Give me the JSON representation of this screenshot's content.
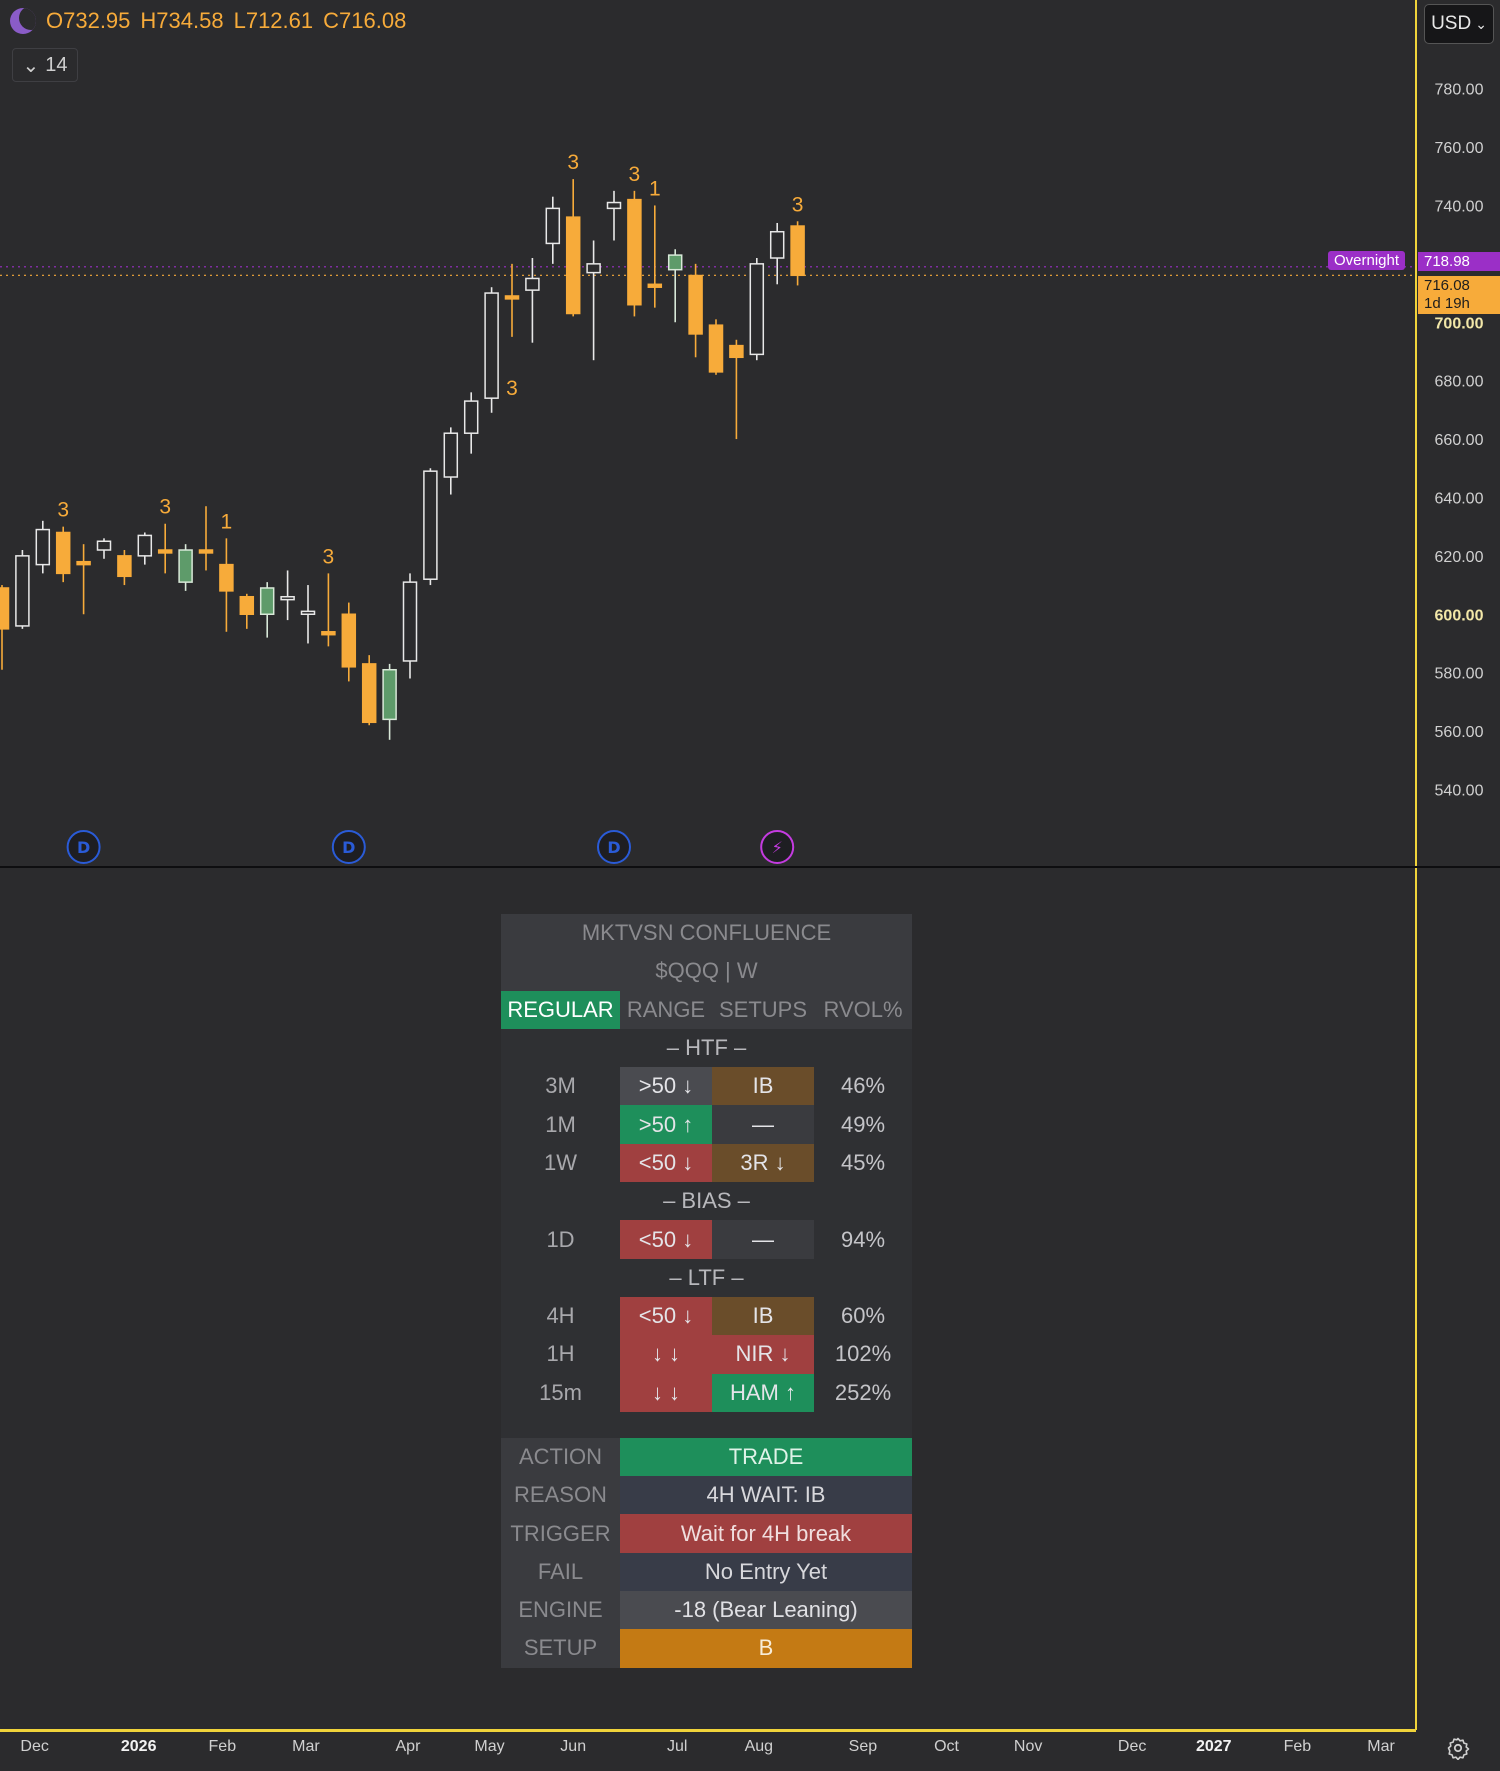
{
  "header": {
    "ohlc": {
      "open": "O732.95",
      "high": "H734.58",
      "low": "L712.61",
      "close": "C716.08"
    },
    "indicator_count": "14",
    "currency": "USD",
    "moon_icon": "moon-icon"
  },
  "tags": {
    "overnight_label": "Overnight",
    "overnight_price": "718.98",
    "last_price": "716.08",
    "countdown": "1d 19h"
  },
  "colors": {
    "bull": "#ffffff",
    "bear": "#f7ab3a",
    "green": "#5e9b6a",
    "grid_bg": "#2b2b2d",
    "accent": "#f0d33a",
    "overnight": "#9b2fc7"
  },
  "chart_data": {
    "type": "candlestick",
    "ylim": [
      525,
      800
    ],
    "yticks": [
      {
        "v": 780,
        "label": "780.00",
        "bold": false
      },
      {
        "v": 760,
        "label": "760.00",
        "bold": false
      },
      {
        "v": 740,
        "label": "740.00",
        "bold": false
      },
      {
        "v": 700,
        "label": "700.00",
        "bold": true
      },
      {
        "v": 680,
        "label": "680.00",
        "bold": false
      },
      {
        "v": 660,
        "label": "660.00",
        "bold": false
      },
      {
        "v": 640,
        "label": "640.00",
        "bold": false
      },
      {
        "v": 620,
        "label": "620.00",
        "bold": false
      },
      {
        "v": 600,
        "label": "600.00",
        "bold": true
      },
      {
        "v": 580,
        "label": "580.00",
        "bold": false
      },
      {
        "v": 560,
        "label": "560.00",
        "bold": false
      },
      {
        "v": 540,
        "label": "540.00",
        "bold": false
      }
    ],
    "xticks": [
      {
        "label": "Dec",
        "idx": 1.6,
        "bold": false
      },
      {
        "label": "2026",
        "idx": 6.7,
        "bold": true
      },
      {
        "label": "Feb",
        "idx": 10.8,
        "bold": false
      },
      {
        "label": "Mar",
        "idx": 14.9,
        "bold": false
      },
      {
        "label": "Apr",
        "idx": 19.9,
        "bold": false
      },
      {
        "label": "May",
        "idx": 23.9,
        "bold": false
      },
      {
        "label": "Jun",
        "idx": 28.0,
        "bold": false
      },
      {
        "label": "Jul",
        "idx": 33.1,
        "bold": false
      },
      {
        "label": "Aug",
        "idx": 37.1,
        "bold": false
      },
      {
        "label": "Sep",
        "idx": 42.2,
        "bold": false
      },
      {
        "label": "Oct",
        "idx": 46.3,
        "bold": false
      },
      {
        "label": "Nov",
        "idx": 50.3,
        "bold": false
      },
      {
        "label": "Dec",
        "idx": 55.4,
        "bold": false
      },
      {
        "label": "2027",
        "idx": 59.4,
        "bold": true
      },
      {
        "label": "Feb",
        "idx": 63.5,
        "bold": false
      },
      {
        "label": "Mar",
        "idx": 67.6,
        "bold": false
      }
    ],
    "overnight": 718.98,
    "last": 716.08,
    "candles": [
      {
        "o": 609,
        "c": 595,
        "h": 610,
        "l": 581,
        "col": "bear"
      },
      {
        "o": 596,
        "c": 620,
        "h": 622,
        "l": 595,
        "col": "bull"
      },
      {
        "o": 617,
        "c": 629,
        "h": 632,
        "l": 614,
        "col": "bull"
      },
      {
        "o": 628,
        "c": 614,
        "h": 630,
        "l": 611,
        "col": "bear",
        "lbl": "3"
      },
      {
        "o": 618,
        "c": 617,
        "h": 624,
        "l": 600,
        "col": "bear"
      },
      {
        "o": 622,
        "c": 625,
        "h": 626,
        "l": 619,
        "col": "bull"
      },
      {
        "o": 620,
        "c": 613,
        "h": 622,
        "l": 610,
        "col": "bear"
      },
      {
        "o": 620,
        "c": 627,
        "h": 628,
        "l": 617,
        "col": "bull"
      },
      {
        "o": 622,
        "c": 621,
        "h": 631,
        "l": 614,
        "col": "bear",
        "lbl": "3"
      },
      {
        "o": 611,
        "c": 622,
        "h": 624,
        "l": 608,
        "col": "green"
      },
      {
        "o": 622,
        "c": 621,
        "h": 637,
        "l": 615,
        "col": "bear"
      },
      {
        "o": 617,
        "c": 608,
        "h": 626,
        "l": 594,
        "col": "bear",
        "lbl": "1"
      },
      {
        "o": 606,
        "c": 600,
        "h": 607,
        "l": 595,
        "col": "bear"
      },
      {
        "o": 600,
        "c": 609,
        "h": 611,
        "l": 592,
        "col": "green"
      },
      {
        "o": 605,
        "c": 606,
        "h": 615,
        "l": 598,
        "col": "bull"
      },
      {
        "o": 600,
        "c": 601,
        "h": 610,
        "l": 590,
        "col": "bull"
      },
      {
        "o": 594,
        "c": 593,
        "h": 614,
        "l": 589,
        "col": "bear",
        "lbl": "3"
      },
      {
        "o": 600,
        "c": 582,
        "h": 604,
        "l": 577,
        "col": "bear"
      },
      {
        "o": 583,
        "c": 563,
        "h": 586,
        "l": 562,
        "col": "bear"
      },
      {
        "o": 564,
        "c": 581,
        "h": 583,
        "l": 557,
        "col": "green"
      },
      {
        "o": 584,
        "c": 611,
        "h": 614,
        "l": 578,
        "col": "bull"
      },
      {
        "o": 612,
        "c": 649,
        "h": 650,
        "l": 610,
        "col": "bull"
      },
      {
        "o": 647,
        "c": 662,
        "h": 664,
        "l": 641,
        "col": "bull"
      },
      {
        "o": 662,
        "c": 673,
        "h": 676,
        "l": 655,
        "col": "bull"
      },
      {
        "o": 674,
        "c": 710,
        "h": 712,
        "l": 669,
        "col": "bull"
      },
      {
        "o": 709,
        "c": 708,
        "h": 720,
        "l": 695,
        "col": "bear",
        "lbl_low": "3"
      },
      {
        "o": 711,
        "c": 715,
        "h": 722,
        "l": 693,
        "col": "bull"
      },
      {
        "o": 727,
        "c": 739,
        "h": 743,
        "l": 720,
        "col": "bull"
      },
      {
        "o": 736,
        "c": 703,
        "h": 749,
        "l": 702,
        "col": "bear",
        "lbl": "3"
      },
      {
        "o": 717,
        "c": 720,
        "h": 728,
        "l": 687,
        "col": "bull"
      },
      {
        "o": 739,
        "c": 741,
        "h": 745,
        "l": 728,
        "col": "bull"
      },
      {
        "o": 742,
        "c": 706,
        "h": 745,
        "l": 702,
        "col": "bear",
        "lbl": "3"
      },
      {
        "o": 713,
        "c": 712,
        "h": 740,
        "l": 705,
        "col": "bear",
        "lbl": "1"
      },
      {
        "o": 718,
        "c": 723,
        "h": 725,
        "l": 700,
        "col": "green"
      },
      {
        "o": 716,
        "c": 696,
        "h": 720,
        "l": 688,
        "col": "bear"
      },
      {
        "o": 699,
        "c": 683,
        "h": 701,
        "l": 682,
        "col": "bear"
      },
      {
        "o": 692,
        "c": 688,
        "h": 694,
        "l": 660,
        "col": "bear"
      },
      {
        "o": 689,
        "c": 720,
        "h": 722,
        "l": 687,
        "col": "bull"
      },
      {
        "o": 722,
        "c": 731,
        "h": 734,
        "l": 713,
        "col": "bull"
      },
      {
        "o": 732.95,
        "c": 716.08,
        "h": 734.58,
        "l": 712.61,
        "col": "bear",
        "lbl": "3"
      }
    ],
    "markers": [
      {
        "idx": 4,
        "label": "D",
        "kind": "div"
      },
      {
        "idx": 17,
        "label": "D",
        "kind": "div"
      },
      {
        "idx": 30,
        "label": "D",
        "kind": "div"
      },
      {
        "idx": 38,
        "label": "⚡",
        "kind": "event"
      }
    ]
  },
  "confluence": {
    "title": "MKTVSN CONFLUENCE",
    "symbol": "$QQQ | W",
    "tabs": [
      "REGULAR",
      "RANGE",
      "SETUPS",
      "RVOL%"
    ],
    "sections": [
      {
        "heading": "– HTF –",
        "rows": [
          {
            "tf": "3M",
            "a": ">50 ↓",
            "ac": "#4a4b50",
            "b": "IB",
            "bc": "#6a4d2a",
            "p": "46%"
          },
          {
            "tf": "1M",
            "a": ">50 ↑",
            "ac": "#1e8f5b",
            "b": "—",
            "bc": "#3a3b3f",
            "p": "49%"
          },
          {
            "tf": "1W",
            "a": "<50 ↓",
            "ac": "#a04040",
            "b": "3R ↓",
            "bc": "#6a4d2a",
            "p": "45%"
          }
        ]
      },
      {
        "heading": "– BIAS –",
        "rows": [
          {
            "tf": "1D",
            "a": "<50 ↓",
            "ac": "#a04040",
            "b": "—",
            "bc": "#3a3b3f",
            "p": "94%"
          }
        ]
      },
      {
        "heading": "– LTF –",
        "rows": [
          {
            "tf": "4H",
            "a": "<50 ↓",
            "ac": "#a04040",
            "b": "IB",
            "bc": "#6a4d2a",
            "p": "60%"
          },
          {
            "tf": "1H",
            "a": "↓ ↓",
            "ac": "#a04040",
            "b": "NIR ↓",
            "bc": "#a04040",
            "p": "102%"
          },
          {
            "tf": "15m",
            "a": "↓ ↓",
            "ac": "#a04040",
            "b": "HAM ↑",
            "bc": "#1e8f5b",
            "p": "252%"
          }
        ]
      }
    ],
    "actions": [
      {
        "label": "ACTION",
        "value": "TRADE",
        "bg": "#1e8f5b",
        "fg": "#dff3e8"
      },
      {
        "label": "REASON",
        "value": "4H WAIT: IB",
        "bg": "#383c48",
        "fg": "#d8d8dc"
      },
      {
        "label": "TRIGGER",
        "value": "Wait for 4H break",
        "bg": "#a04040",
        "fg": "#f0dede"
      },
      {
        "label": "FAIL",
        "value": "No Entry Yet",
        "bg": "#383c48",
        "fg": "#d8d8dc"
      },
      {
        "label": "ENGINE",
        "value": "-18 (Bear Leaning)",
        "bg": "#4a4b50",
        "fg": "#e0e0e4"
      },
      {
        "label": "SETUP",
        "value": "B",
        "bg": "#c47a14",
        "fg": "#f7ecd8"
      }
    ]
  }
}
